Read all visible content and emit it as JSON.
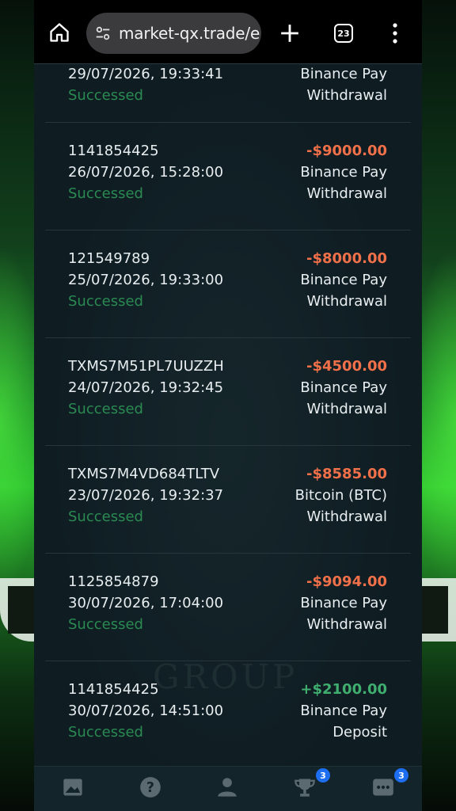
{
  "browser": {
    "url": "market-qx.trade/e",
    "tab_count": "23"
  },
  "partial_row": {
    "date": "29/07/2026, 19:33:41",
    "status": "Successed",
    "method": "Binance Pay",
    "type": "Withdrawal"
  },
  "transactions": [
    {
      "id": "1141854425",
      "date": "26/07/2026, 15:28:00",
      "status": "Successed",
      "amount": "-$9000.00",
      "method": "Binance Pay",
      "type": "Withdrawal"
    },
    {
      "id": "121549789",
      "date": "25/07/2026, 19:33:00",
      "status": "Successed",
      "amount": "-$8000.00",
      "method": "Binance Pay",
      "type": "Withdrawal"
    },
    {
      "id": "TXMS7M51PL7UUZZH",
      "date": "24/07/2026, 19:32:45",
      "status": "Successed",
      "amount": "-$4500.00",
      "method": "Binance Pay",
      "type": "Withdrawal"
    },
    {
      "id": "TXMS7M4VD684TLTV",
      "date": "23/07/2026, 19:32:37",
      "status": "Successed",
      "amount": "-$8585.00",
      "method": "Bitcoin (BTC)",
      "type": "Withdrawal"
    },
    {
      "id": "1125854879",
      "date": "30/07/2026, 17:04:00",
      "status": "Successed",
      "amount": "-$9094.00",
      "method": "Binance Pay",
      "type": "Withdrawal"
    },
    {
      "id": "1141854425",
      "date": "30/07/2026, 14:51:00",
      "status": "Successed",
      "amount": "+$2100.00",
      "method": "Binance Pay",
      "type": "Deposit"
    }
  ],
  "bottom_nav": {
    "tournaments_badge": "3",
    "chat_badge": "3"
  },
  "watermark": "GROUP",
  "colors": {
    "withdrawal_amount": "#f0704a",
    "deposit_amount": "#3fae6e",
    "status_success": "#2a8a52",
    "badge": "#1d6ef0"
  }
}
